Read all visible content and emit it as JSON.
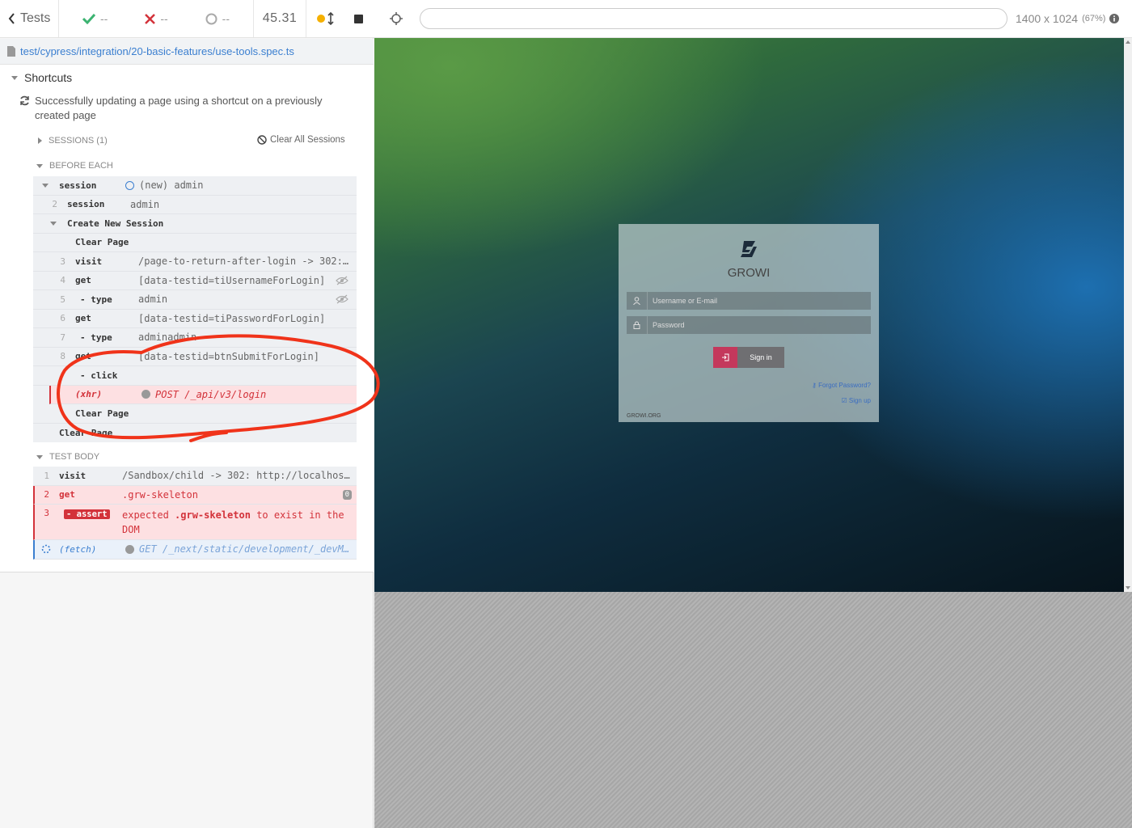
{
  "header": {
    "tests_label": "Tests",
    "passed": "--",
    "failed": "--",
    "pending": "--",
    "duration": "45.31"
  },
  "spec_file": "test/cypress/integration/20-basic-features/use-tools.spec.ts",
  "suite": {
    "title": "Shortcuts",
    "test_title": "Successfully updating a page using a shortcut on a previously created page",
    "sessions_label": "SESSIONS (1)",
    "clear_sessions": "Clear All Sessions",
    "before_each_label": "BEFORE EACH",
    "test_body_label": "TEST BODY"
  },
  "before_each": [
    {
      "num": "",
      "name": "session",
      "msg": "(new) admin"
    },
    {
      "num": "2",
      "name": "session",
      "msg": "admin"
    },
    {
      "num": "",
      "name": "Create New Session",
      "msg": ""
    },
    {
      "num": "",
      "name": "Clear Page",
      "msg": ""
    },
    {
      "num": "3",
      "name": "visit",
      "msg": "/page-to-return-after-login -> 302:…"
    },
    {
      "num": "4",
      "name": "get",
      "msg": "[data-testid=tiUsernameForLogin]"
    },
    {
      "num": "5",
      "name": "- type",
      "msg": "admin"
    },
    {
      "num": "6",
      "name": "get",
      "msg": "[data-testid=tiPasswordForLogin]"
    },
    {
      "num": "7",
      "name": "- type",
      "msg": "adminadmin"
    },
    {
      "num": "8",
      "name": "get",
      "msg": "[data-testid=btnSubmitForLogin]"
    },
    {
      "num": "",
      "name": "- click",
      "msg": ""
    },
    {
      "num": "",
      "name": "(xhr)",
      "msg": "POST /_api/v3/login"
    },
    {
      "num": "",
      "name": "Clear Page",
      "msg": ""
    },
    {
      "num": "",
      "name": "Clear Page",
      "msg": ""
    }
  ],
  "test_body": [
    {
      "num": "1",
      "name": "visit",
      "msg": "/Sandbox/child -> 302: http://localhos…"
    },
    {
      "num": "2",
      "name": "get",
      "msg": ".grw-skeleton",
      "badge": "0"
    },
    {
      "num": "3",
      "name": "- assert",
      "msg_prefix": "expected",
      "msg_strong": ".grw-skeleton",
      "msg_suffix": "to exist in the",
      "msg_line2": "DOM"
    },
    {
      "num": "",
      "name": "(fetch)",
      "msg": "GET /_next/static/development/_devM…"
    }
  ],
  "aut": {
    "url": "",
    "viewport": "1400 x 1024",
    "scale": "(67%)"
  },
  "login": {
    "brand": "GROWI",
    "username_placeholder": "Username or E-mail",
    "password_placeholder": "Password",
    "signin_label": "Sign in",
    "forgot_label": "Forgot Password?",
    "signup_label": "Sign up",
    "footer": "GROWI.ORG"
  },
  "colors": {
    "pass": "#3cb371",
    "fail": "#d3323a",
    "accent": "#3b7fd0",
    "annotation": "#f0331a"
  }
}
